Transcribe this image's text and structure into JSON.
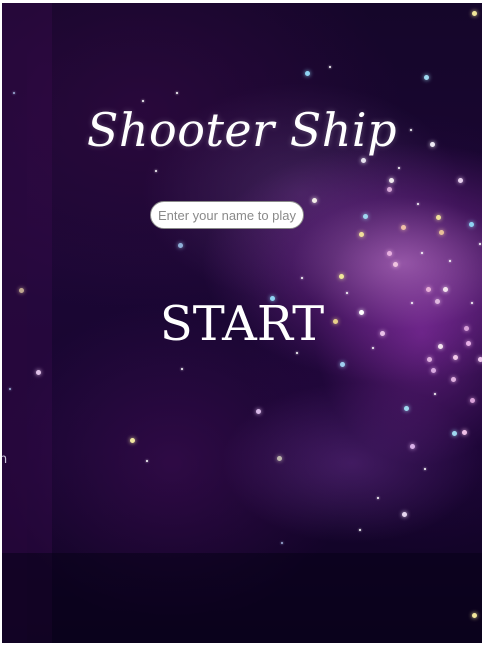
{
  "game": {
    "title": "Shooter Ship",
    "name_input": {
      "placeholder": "Enter your name to play",
      "value": ""
    },
    "start_label": "START",
    "edge_glyph": "n"
  },
  "colors": {
    "background": "#0d0521",
    "nebula": "#c070d8",
    "text": "#ffffff",
    "input_bg": "#ffffff",
    "input_border": "#8a8a8a"
  },
  "icons": [
    "star-icon"
  ]
}
